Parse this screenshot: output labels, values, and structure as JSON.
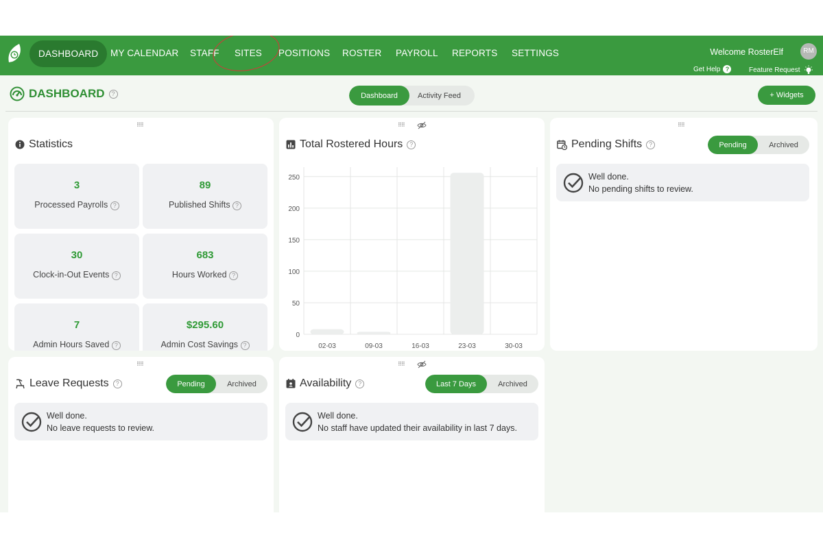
{
  "nav": {
    "items": [
      {
        "label": "DASHBOARD"
      },
      {
        "label": "MY CALENDAR"
      },
      {
        "label": "STAFF"
      },
      {
        "label": "SITES"
      },
      {
        "label": "POSITIONS"
      },
      {
        "label": "ROSTER"
      },
      {
        "label": "PAYROLL"
      },
      {
        "label": "REPORTS"
      },
      {
        "label": "SETTINGS"
      }
    ],
    "welcome": "Welcome RosterElf",
    "avatar_initials": "RM",
    "get_help": "Get Help",
    "feature_request": "Feature Request",
    "accent_color": "#3a9a3f"
  },
  "header": {
    "title": "DASHBOARD",
    "tabs": [
      {
        "label": "Dashboard"
      },
      {
        "label": "Activity Feed"
      }
    ],
    "widgets_button": "+ Widgets"
  },
  "statistics": {
    "title": "Statistics",
    "tiles": [
      {
        "value": "3",
        "label": "Processed Payrolls"
      },
      {
        "value": "89",
        "label": "Published Shifts"
      },
      {
        "value": "30",
        "label": "Clock-in-Out Events"
      },
      {
        "value": "683",
        "label": "Hours Worked"
      },
      {
        "value": "7",
        "label": "Admin Hours Saved"
      },
      {
        "value": "$295.60",
        "label": "Admin Cost Savings"
      }
    ]
  },
  "hours_card": {
    "title": "Total Rostered Hours"
  },
  "chart_data": {
    "type": "bar",
    "title": "Total Rostered Hours",
    "categories": [
      "02-03",
      "09-03",
      "16-03",
      "23-03",
      "30-03"
    ],
    "values": [
      8,
      4,
      0,
      256,
      0
    ],
    "yticks": [
      0,
      50,
      100,
      150,
      200,
      250
    ],
    "ylim": [
      0,
      265
    ],
    "grid": true
  },
  "pending_shifts": {
    "title": "Pending Shifts",
    "toggle": [
      {
        "label": "Pending"
      },
      {
        "label": "Archived"
      }
    ],
    "line1": "Well done.",
    "line2": "No pending shifts to review."
  },
  "leave_requests": {
    "title": "Leave Requests",
    "toggle": [
      {
        "label": "Pending"
      },
      {
        "label": "Archived"
      }
    ],
    "line1": "Well done.",
    "line2": "No leave requests to review."
  },
  "availability": {
    "title": "Availability",
    "toggle": [
      {
        "label": "Last 7 Days"
      },
      {
        "label": "Archived"
      }
    ],
    "line1": "Well done.",
    "line2": "No staff have updated their availability in last 7 days."
  }
}
